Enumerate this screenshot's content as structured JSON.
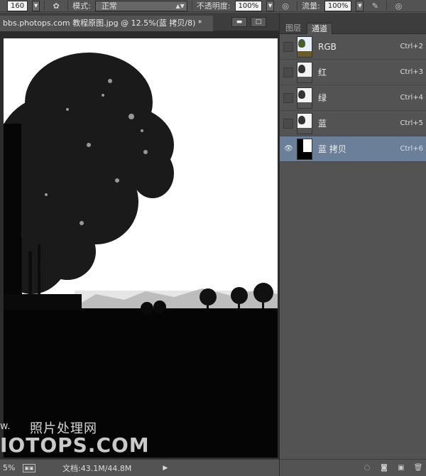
{
  "options_bar": {
    "brush_size": "160",
    "mode_label": "模式:",
    "mode_value": "正常",
    "opacity_label": "不透明度:",
    "opacity_value": "100%",
    "flow_label": "流量:",
    "flow_value": "100%"
  },
  "document": {
    "tab_title": "bbs.photops.com 教程原图.jpg @ 12.5%(蓝 拷贝/8) *",
    "minimize_glyph": "▬",
    "maximize_glyph": "□"
  },
  "canvas": {
    "watermark_small": "w.",
    "watermark_cn": "照片处理网",
    "watermark_big": "IOTOPS.COM"
  },
  "status_bar": {
    "zoom": "5%",
    "doc_info": "文档:43.1M/44.8M",
    "arrow": "▶"
  },
  "panel": {
    "tabs": [
      {
        "label": "图层",
        "active": false
      },
      {
        "label": "通道",
        "active": true
      }
    ],
    "channels": [
      {
        "name": "RGB",
        "shortcut": "Ctrl+2",
        "visible": false,
        "selected": false,
        "thumb": "color"
      },
      {
        "name": "红",
        "shortcut": "Ctrl+3",
        "visible": false,
        "selected": false,
        "thumb": "gray"
      },
      {
        "name": "绿",
        "shortcut": "Ctrl+4",
        "visible": false,
        "selected": false,
        "thumb": "gray"
      },
      {
        "name": "蓝",
        "shortcut": "Ctrl+5",
        "visible": false,
        "selected": false,
        "thumb": "gray"
      },
      {
        "name": "蓝 拷贝",
        "shortcut": "Ctrl+6",
        "visible": true,
        "selected": true,
        "thumb": "inverse"
      }
    ]
  },
  "colors": {
    "selected_row": "#6c7f99",
    "panel_bg": "#535353",
    "canvas_bg": "#ffffff"
  }
}
